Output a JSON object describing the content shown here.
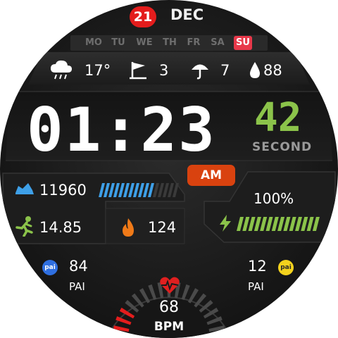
{
  "date": {
    "day": "21",
    "month": "DEC"
  },
  "weekdays": [
    {
      "label": "MO",
      "active": false
    },
    {
      "label": "TU",
      "active": false
    },
    {
      "label": "WE",
      "active": false
    },
    {
      "label": "TH",
      "active": false
    },
    {
      "label": "FR",
      "active": false
    },
    {
      "label": "SA",
      "active": false
    },
    {
      "label": "SU",
      "active": true
    }
  ],
  "weather": {
    "temperature": "17°",
    "wind": "3",
    "uv": "7",
    "humidity": "88",
    "icons": [
      "cloud-rain-icon",
      "flag-icon",
      "umbrella-icon",
      "water-drop-icon"
    ]
  },
  "clock": {
    "time": "01:23",
    "seconds": "42",
    "seconds_label": "SECOND",
    "ampm": "AM"
  },
  "steps": {
    "value": "11960",
    "progress_percent": 70
  },
  "battery": {
    "value": "100%",
    "progress_percent": 100
  },
  "distance": {
    "value": "14.85"
  },
  "calories": {
    "value": "124"
  },
  "pai_left": {
    "value": "84",
    "label": "PAI",
    "badge": "pai"
  },
  "pai_right": {
    "value": "12",
    "label": "PAI",
    "badge": "pai"
  },
  "heart": {
    "value": "68",
    "label": "BPM",
    "gauge_fraction": 0.15
  },
  "colors": {
    "accent_red": "#e41d1d",
    "accent_orange": "#d9420f",
    "seconds_green": "#8bc34a",
    "steps_blue": "#3ea0e8",
    "battery_green": "#8bc34a",
    "pai_blue": "#2f6fe0",
    "pai_yellow": "#f3d21d"
  }
}
